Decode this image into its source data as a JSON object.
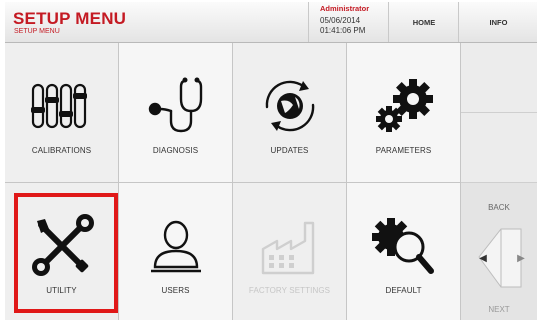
{
  "header": {
    "title": "SETUP MENU",
    "subtitle": "SETUP MENU",
    "user": "Administrator",
    "date": "05/06/2014",
    "time": "01:41:06 PM",
    "home_label": "HOME",
    "info_label": "INFO"
  },
  "tiles": [
    {
      "label": "CALIBRATIONS",
      "icon": "sliders-icon"
    },
    {
      "label": "DIAGNOSIS",
      "icon": "stethoscope-icon"
    },
    {
      "label": "UPDATES",
      "icon": "update-globe-icon"
    },
    {
      "label": "PARAMETERS",
      "icon": "gears-icon"
    },
    {
      "label": "UTILITY",
      "icon": "tools-icon"
    },
    {
      "label": "USERS",
      "icon": "user-icon"
    },
    {
      "label": "FACTORY SETTINGS",
      "icon": "factory-icon",
      "disabled": true
    },
    {
      "label": "DEFAULT",
      "icon": "gear-search-icon"
    }
  ],
  "side": {
    "back_label": "BACK",
    "next_label": "NEXT"
  },
  "colors": {
    "brand_red": "#c41a23",
    "highlight": "#e01818"
  }
}
